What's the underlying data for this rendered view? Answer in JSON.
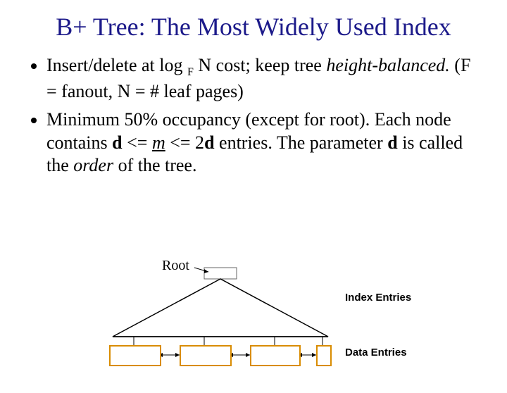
{
  "title": "B+ Tree:  The Most Widely Used Index",
  "bullets": {
    "b1_p1": "Insert/delete at log ",
    "b1_sub": "F",
    "b1_p2": " N cost; keep tree ",
    "b1_italic": "height-balanced.",
    "b1_p3": "   (F = fanout, N = # leaf pages)",
    "b2_p1": "Minimum 50% occupancy (except for root).  Each node contains ",
    "b2_bold1": "d",
    "b2_p2": " <=  ",
    "b2_under": "m",
    "b2_p3": "  <= 2",
    "b2_bold2": "d",
    "b2_p4": " entries.  The parameter ",
    "b2_bold3": "d",
    "b2_p5": " is called the ",
    "b2_italic": "order",
    "b2_p6": " of the tree."
  },
  "diagram": {
    "root_label": "Root",
    "index_label": "Index Entries",
    "data_label": "Data Entries"
  }
}
